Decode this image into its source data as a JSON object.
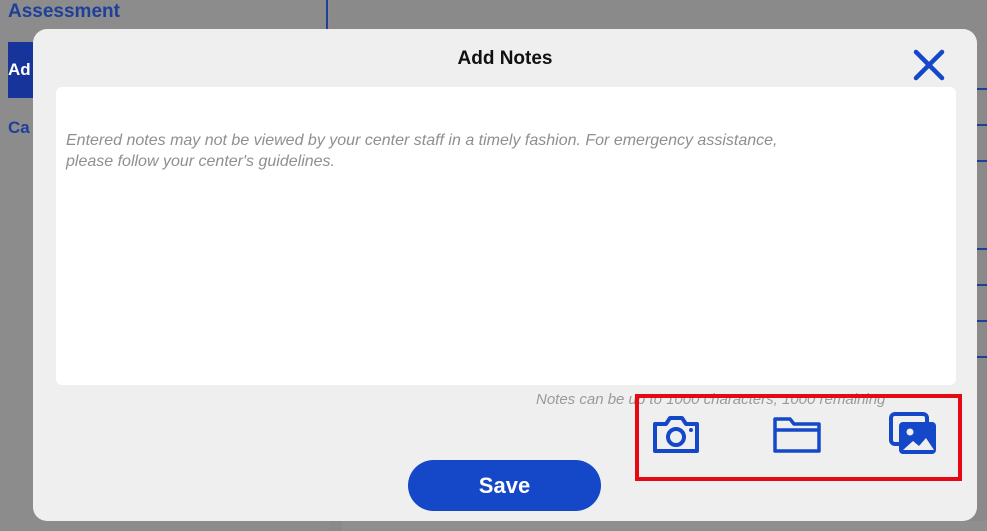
{
  "background": {
    "top_label": "Assessment",
    "nav_selected_label": "Ad",
    "nav_item_label": "Ca"
  },
  "modal": {
    "title": "Add Notes",
    "close_icon": "close-x-icon",
    "notes_placeholder": "Entered notes may not be viewed by your center staff in a timely fashion. For emergency assistance, please follow your center's guidelines.",
    "char_count_text": "Notes can be up to 1000 characters; 1000 remaining",
    "attachments": [
      {
        "icon": "camera-icon"
      },
      {
        "icon": "folder-icon"
      },
      {
        "icon": "photo-gallery-icon"
      }
    ],
    "save_label": "Save"
  },
  "colors": {
    "accent": "#1448c8",
    "highlight_box": "#e50914",
    "overlay": "#8a8a8a"
  }
}
